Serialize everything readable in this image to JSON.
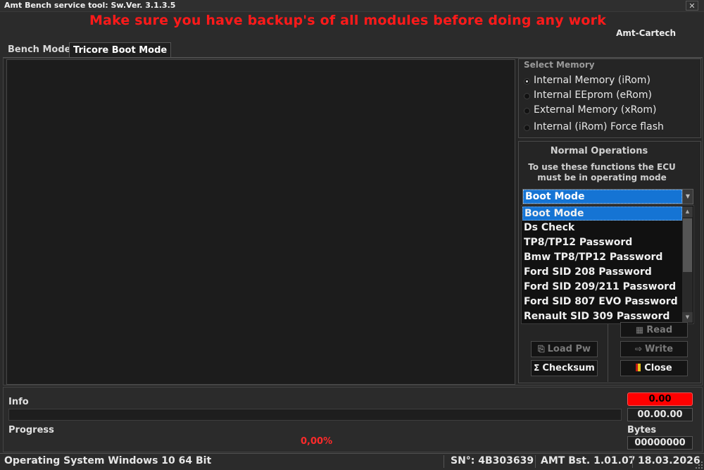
{
  "window": {
    "title": "Amt Bench service tool:  Sw.Ver. 3.1.3.5",
    "close_glyph": "✕"
  },
  "header": {
    "warning": "Make sure you have backup's of all modules before doing any work",
    "brand": "Amt-Cartech"
  },
  "tabs": [
    {
      "label": "Bench Mode",
      "active": false
    },
    {
      "label": "Tricore Boot Mode",
      "active": true
    }
  ],
  "memory": {
    "title": "Select Memory",
    "options": [
      {
        "label": "Internal Memory (iRom)",
        "selected": true
      },
      {
        "label": "Internal EEprom (eRom)",
        "selected": false
      },
      {
        "label": "External Memory (xRom)",
        "selected": false
      },
      {
        "label": "Internal (iRom) Force flash",
        "selected": false
      }
    ]
  },
  "operations": {
    "title": "Normal Operations",
    "hint": "To use these functions the ECU must be in operating mode",
    "selected": "Boot Mode",
    "options": [
      "Boot Mode",
      "Ds Check",
      "TP8/TP12 Password",
      "Bmw TP8/TP12 Password",
      "Ford SID 208 Password",
      "Ford SID 209/211 Password",
      "Ford SID 807 EVO Password",
      "Renault SID 309 Password"
    ]
  },
  "buttons": {
    "read": "Read",
    "load_pw": "Load Pw",
    "write": "Write",
    "checksum": "Checksum",
    "close": "Close"
  },
  "bottom": {
    "info_label": "Info",
    "progress_label": "Progress",
    "progress_percent": "0,00%",
    "red_value": "0.00",
    "value": "00.00.00",
    "bytes_label": "Bytes",
    "bytes_value": "00000000"
  },
  "status": {
    "os": "Operating System Windows 10 64 Bit",
    "serial": "SN°: 4B303639",
    "version": "AMT Bst. 1.01.07",
    "date": "18.03.2026"
  },
  "colors": {
    "warning": "#ff1a1a",
    "selection": "#1574d4",
    "alert_box": "#ff0000"
  }
}
